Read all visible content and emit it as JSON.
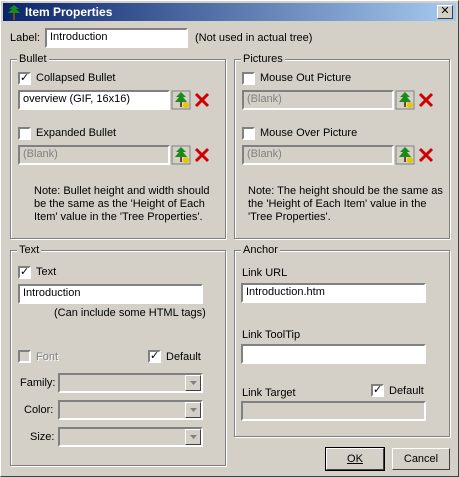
{
  "window": {
    "title": "Item Properties",
    "close_glyph": "✕"
  },
  "label_field": {
    "label": "Label:",
    "value": "Introduction",
    "hint": "(Not used in actual tree)"
  },
  "bullet": {
    "legend": "Bullet",
    "collapsed": {
      "label": "Collapsed Bullet",
      "checked": true,
      "value": "overview (GIF, 16x16)"
    },
    "expanded": {
      "label": "Expanded Bullet",
      "checked": false,
      "value": "(Blank)"
    },
    "note": "Note: Bullet height and width should be the same as the 'Height of Each Item' value in the 'Tree Properties'."
  },
  "pictures": {
    "legend": "Pictures",
    "mouse_out": {
      "label": "Mouse Out Picture",
      "checked": false,
      "value": "(Blank)"
    },
    "mouse_over": {
      "label": "Mouse Over Picture",
      "checked": false,
      "value": "(Blank)"
    },
    "note": "Note: The height should be the same as the 'Height of Each Item' value in the 'Tree Properties'."
  },
  "text": {
    "legend": "Text",
    "text_checkbox": {
      "label": "Text",
      "checked": true
    },
    "value": "Introduction",
    "hint": "(Can include some HTML tags)",
    "font": {
      "label": "Font",
      "checked": false
    },
    "default": {
      "label": "Default",
      "checked": true
    },
    "family_label": "Family:",
    "color_label": "Color:",
    "size_label": "Size:"
  },
  "anchor": {
    "legend": "Anchor",
    "link_url_label": "Link URL",
    "link_url_value": "Introduction.htm",
    "link_tooltip_label": "Link ToolTip",
    "link_tooltip_value": "",
    "link_target_label": "Link Target",
    "default": {
      "label": "Default",
      "checked": true
    },
    "link_target_value": ""
  },
  "buttons": {
    "ok": "OK",
    "cancel": "Cancel"
  },
  "icons": {
    "check_glyph": "✓",
    "picture_icon": "tree-picture-icon",
    "clear_icon": "red-x-icon"
  }
}
